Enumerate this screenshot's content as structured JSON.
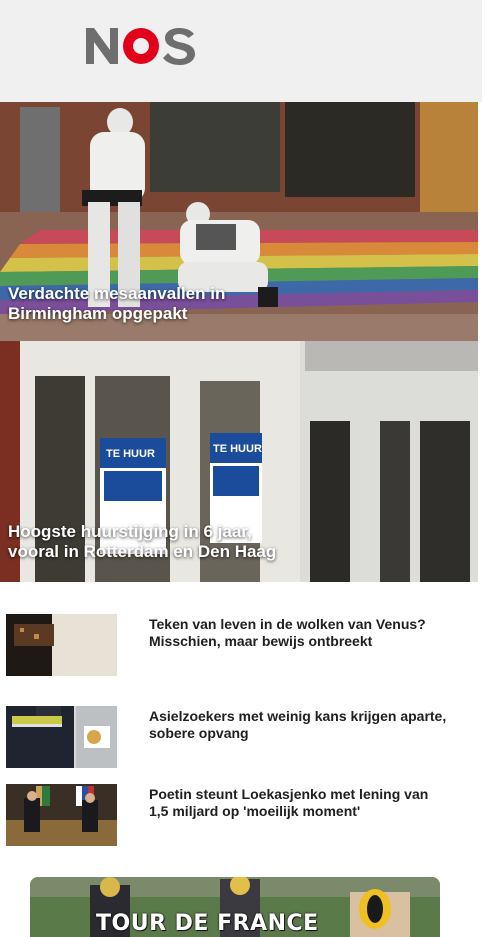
{
  "header": {
    "logo_text": "NOS",
    "colors": {
      "background": "#f0f0f0",
      "logo_letters": "#6e6e6e",
      "logo_o": "#e2001a"
    }
  },
  "heroes": [
    {
      "title_lines": [
        "Verdachte mesaanvallen in",
        "Birmingham opgepakt"
      ],
      "image": "forensic-investigators-street-photo"
    },
    {
      "title_lines": [
        "Hoogste huurstijging in 6 jaar,",
        "vooral in Rotterdam en Den Haag"
      ],
      "image": "te-huur-signs-window-photo"
    }
  ],
  "list": [
    {
      "title": "Teken van leven in de wolken van Venus? Misschien, maar bewijs ontbreekt",
      "image": "venus-clouds-photo"
    },
    {
      "title": "Asielzoekers met weinig kans krijgen aparte, sobere opvang",
      "image": "police-officer-photo"
    },
    {
      "title": "Poetin steunt Loekasjenko met lening van 1,5 miljard op 'moeilijk moment'",
      "image": "putin-lukashenko-meeting-photo"
    }
  ],
  "banner": {
    "text": "TOUR DE FRANCE",
    "image": "cyclists-photo"
  }
}
